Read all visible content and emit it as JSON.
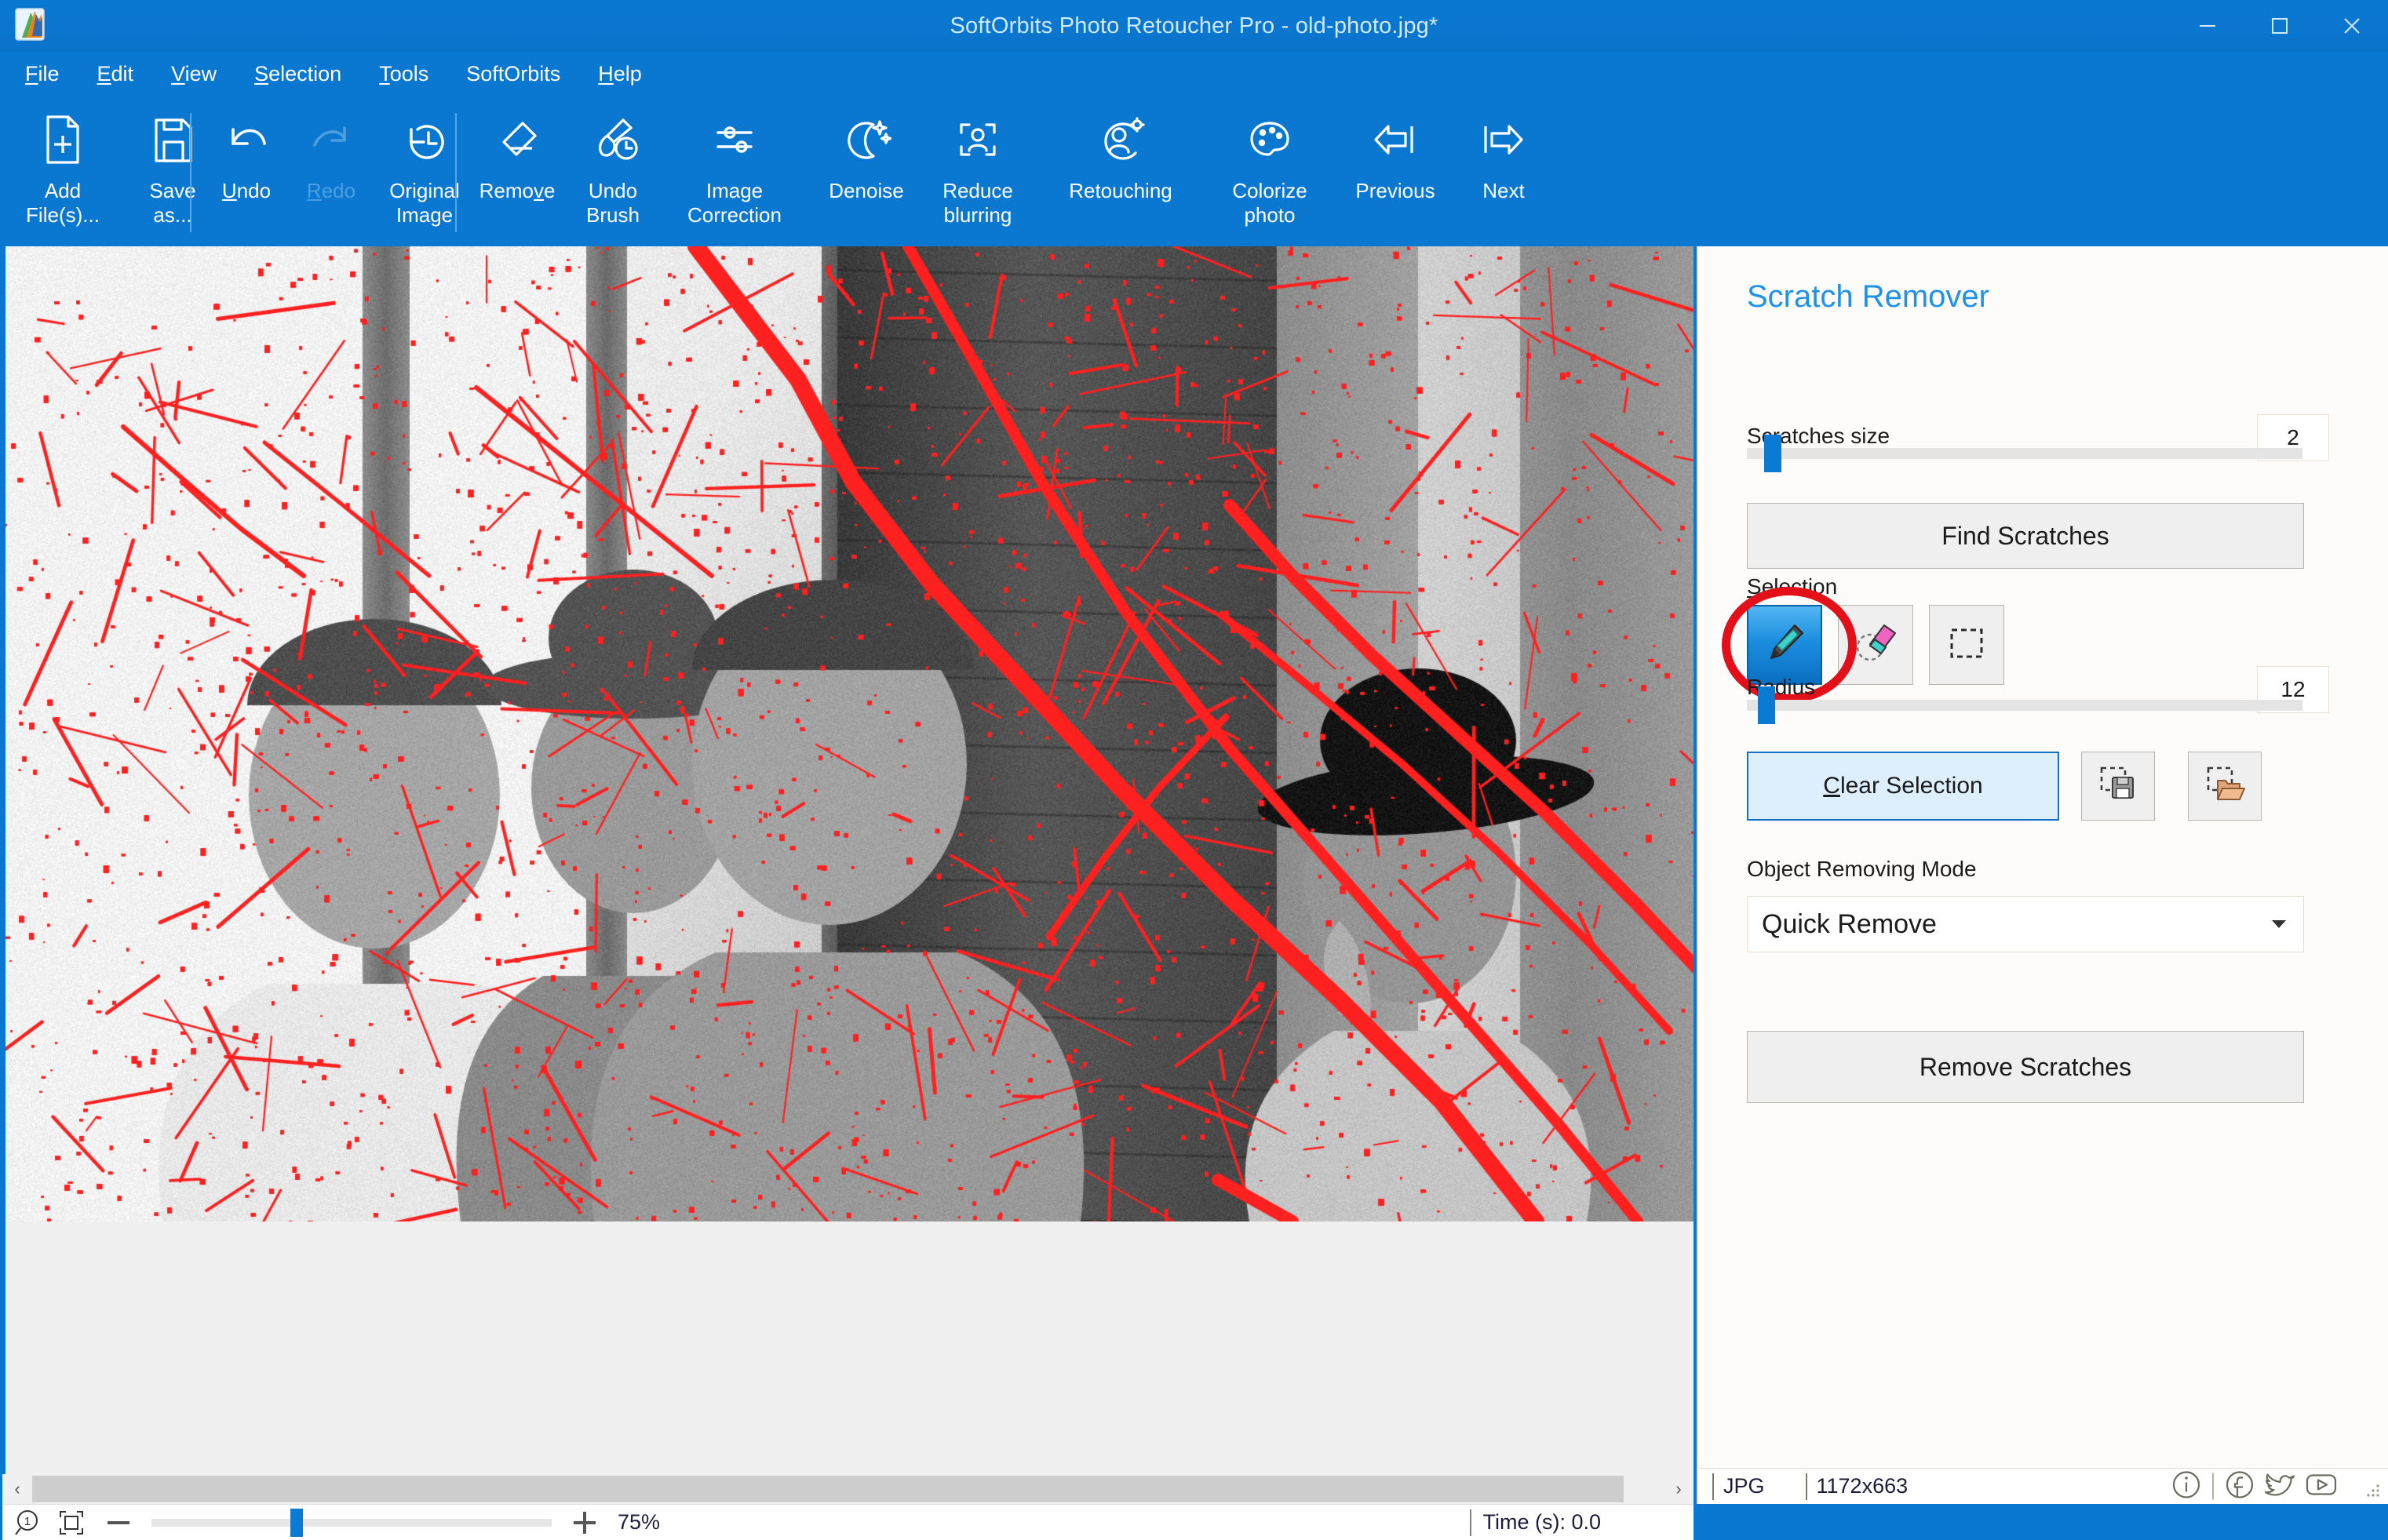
{
  "window": {
    "title": "SoftOrbits Photo Retoucher Pro - old-photo.jpg*",
    "app_icon": "softorbits-logo-icon",
    "minimize": "minimize-icon",
    "maximize": "maximize-icon",
    "close": "close-icon",
    "accent": "#0a78d1"
  },
  "menubar": {
    "items": [
      {
        "label": "File",
        "accel": "F"
      },
      {
        "label": "Edit",
        "accel": "E"
      },
      {
        "label": "View",
        "accel": "V"
      },
      {
        "label": "Selection",
        "accel": "S"
      },
      {
        "label": "Tools",
        "accel": "T"
      },
      {
        "label": "SoftOrbits",
        "accel": ""
      },
      {
        "label": "Help",
        "accel": "H"
      }
    ]
  },
  "toolbar": {
    "items": [
      {
        "label": "Add\nFile(s)...",
        "icon": "document-add-icon",
        "enabled": true
      },
      {
        "label": "Save\nas...",
        "icon": "floppy-save-icon",
        "enabled": true
      },
      {
        "label": "Undo",
        "icon": "undo-arrow-icon",
        "enabled": true
      },
      {
        "label": "Redo",
        "icon": "redo-arrow-icon",
        "enabled": false
      },
      {
        "label": "Original\nImage",
        "icon": "history-clock-icon",
        "enabled": true
      },
      {
        "label": "Remove",
        "icon": "eraser-icon",
        "enabled": true
      },
      {
        "label": "Undo\nBrush",
        "icon": "brush-clock-icon",
        "enabled": true
      },
      {
        "label": "Image\nCorrection",
        "icon": "sliders-icon",
        "enabled": true
      },
      {
        "label": "Denoise",
        "icon": "moon-sparkle-icon",
        "enabled": true
      },
      {
        "label": "Reduce\nblurring",
        "icon": "portrait-focus-icon",
        "enabled": true
      },
      {
        "label": "Retouching",
        "icon": "person-gear-icon",
        "enabled": true
      },
      {
        "label": "Colorize\nphoto",
        "icon": "palette-icon",
        "enabled": true
      },
      {
        "label": "Previous",
        "icon": "arrow-left-icon",
        "enabled": true
      },
      {
        "label": "Next",
        "icon": "arrow-right-icon",
        "enabled": true
      }
    ]
  },
  "canvas": {
    "image_name": "old-photo.jpg",
    "overlay_color": "#ff2020",
    "description": "Vintage black-and-white photograph of three boys and a man in hats on a porch, overlaid with red scratch-detection marks"
  },
  "panel": {
    "title": "Scratch Remover",
    "scratches_size_label": "Scratches size",
    "scratches_size_value": "2",
    "scratches_size_pos_pct": 6,
    "find_scratches_label": "Find Scratches",
    "selection_label": "Selection",
    "selection_accel": "S",
    "tools": [
      {
        "name": "marker-pen-tool",
        "icon": "marker-pen-icon",
        "active": true
      },
      {
        "name": "eraser-tool",
        "icon": "eraser-selection-icon",
        "active": false
      },
      {
        "name": "rectangle-select-tool",
        "icon": "dashed-rectangle-icon",
        "active": false
      }
    ],
    "radius_label": "Radius",
    "radius_value": "12",
    "radius_pos_pct": 4,
    "clear_selection_label": "Clear Selection",
    "clear_selection_accel": "C",
    "save_selection_icon": "save-selection-icon",
    "load_selection_icon": "load-selection-icon",
    "object_mode_label": "Object Removing Mode",
    "object_mode_value": "Quick Remove",
    "remove_scratches_label": "Remove Scratches"
  },
  "statusbar": {
    "zoom_one_to_one_icon": "zoom-actual-size-icon",
    "fit_icon": "fit-to-window-icon",
    "zoom_out_icon": "minus-icon",
    "zoom_in_icon": "plus-icon",
    "zoom_percent": "75%",
    "zoom_slider_pct": 35,
    "time_label": "Time (s): 0.0",
    "format": "JPG",
    "dimensions": "1172x663",
    "social": [
      {
        "name": "info-icon"
      },
      {
        "name": "facebook-icon"
      },
      {
        "name": "twitter-icon"
      },
      {
        "name": "youtube-icon"
      }
    ]
  }
}
